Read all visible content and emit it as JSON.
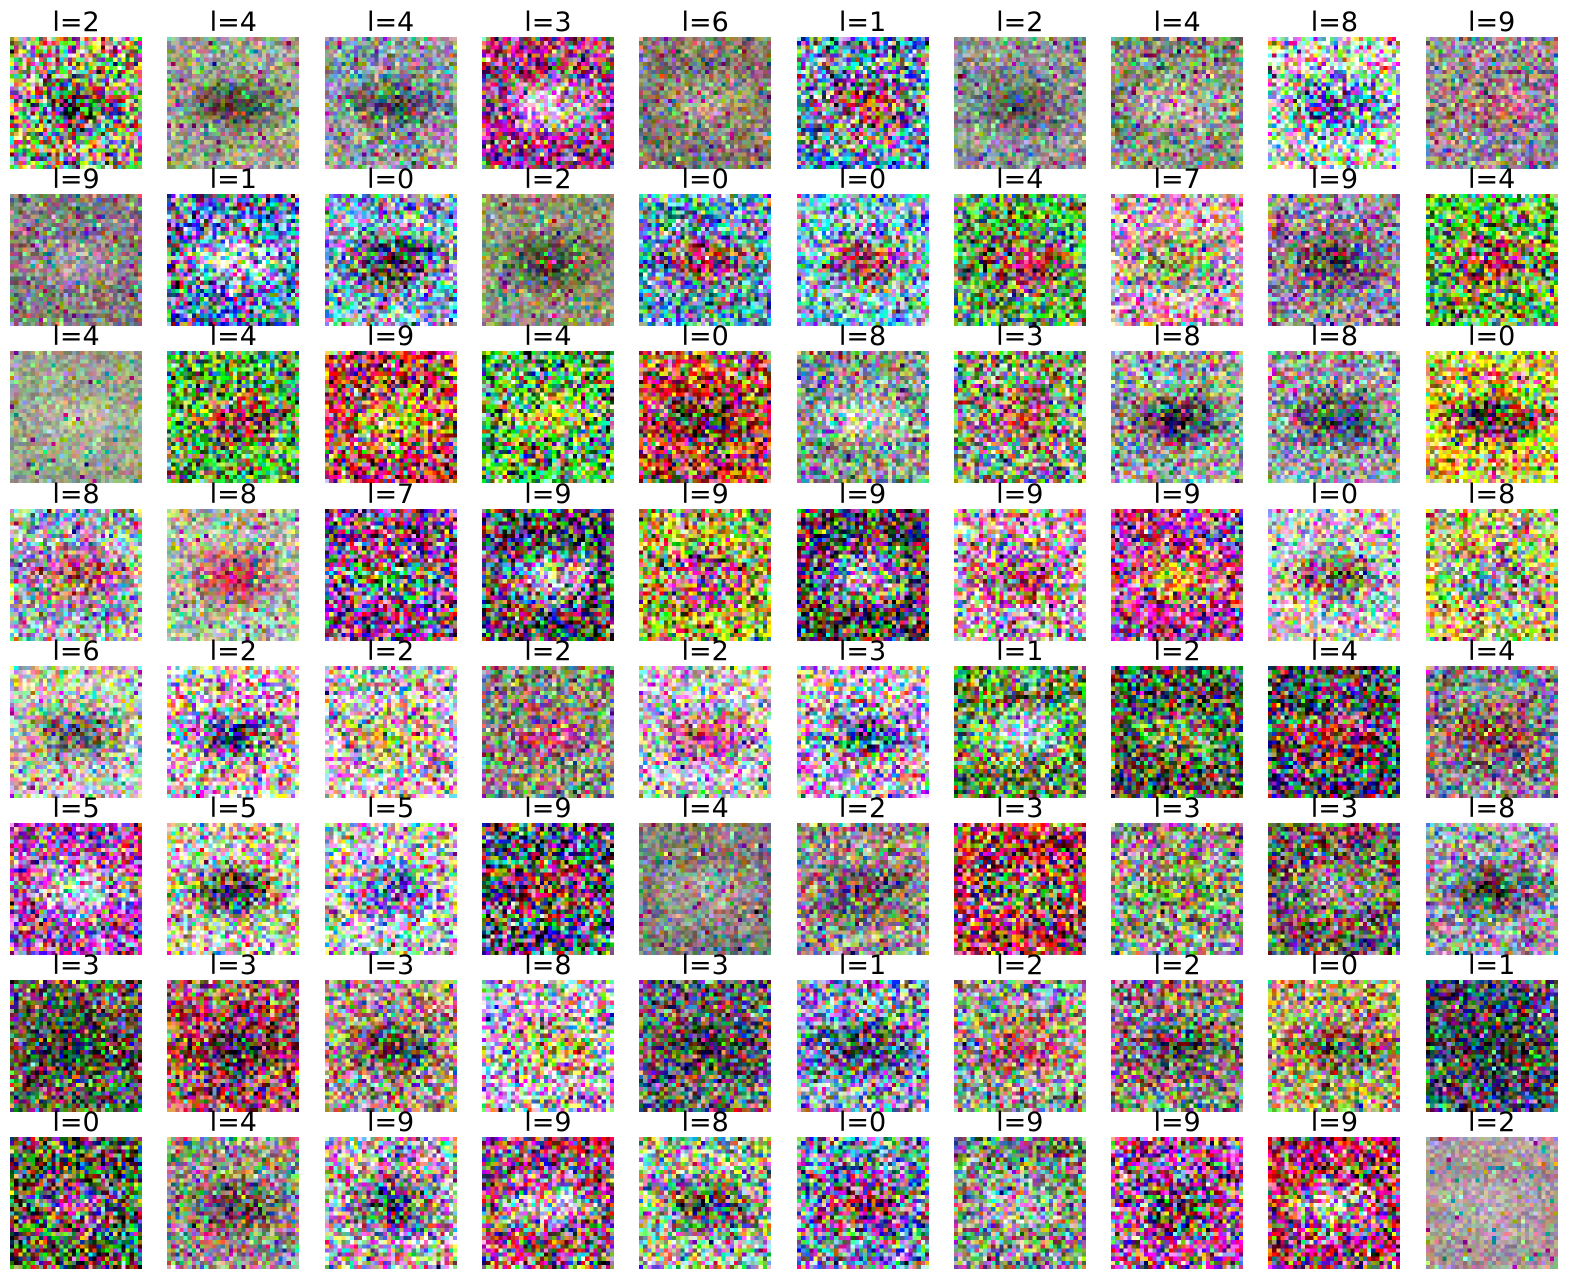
{
  "label_prefix": "l=",
  "grid": {
    "rows": 8,
    "cols": 10
  },
  "labels": [
    [
      2,
      4,
      4,
      3,
      6,
      1,
      2,
      4,
      8,
      9
    ],
    [
      9,
      1,
      0,
      2,
      0,
      0,
      4,
      7,
      9,
      4
    ],
    [
      4,
      4,
      9,
      4,
      0,
      8,
      3,
      8,
      8,
      0
    ],
    [
      8,
      8,
      7,
      9,
      9,
      9,
      9,
      9,
      0,
      8
    ],
    [
      6,
      2,
      2,
      2,
      2,
      3,
      1,
      2,
      4,
      4
    ],
    [
      5,
      5,
      5,
      9,
      4,
      2,
      3,
      3,
      3,
      8
    ],
    [
      3,
      3,
      3,
      8,
      3,
      1,
      2,
      2,
      0,
      1
    ],
    [
      0,
      4,
      9,
      9,
      8,
      0,
      9,
      9,
      9,
      2
    ]
  ],
  "images": [
    [
      {
        "content": "noisy colorful patch with dark horizontal blob in center",
        "palette": [
          "#9aa07a",
          "#3a3a2e",
          "#c8c050"
        ],
        "noise": 0.9
      },
      {
        "content": "muted greenish-gray patch with small dark spot in center",
        "palette": [
          "#9aa088",
          "#3a3a30",
          "#b0b098"
        ],
        "noise": 0.4
      },
      {
        "content": "gray-blue patch with three dark vertical marks",
        "palette": [
          "#8a93a0",
          "#3e4048",
          "#b8b8b0"
        ],
        "noise": 0.5
      },
      {
        "content": "bright white-blue circular glow on dark red-blue background",
        "palette": [
          "#b04080",
          "#e8e8ff",
          "#202050"
        ],
        "noise": 0.8
      },
      {
        "content": "brownish-gray patch with soft light blob",
        "palette": [
          "#8a8070",
          "#c0b090",
          "#5a5650"
        ],
        "noise": 0.4
      },
      {
        "content": "blue oval centered on multicolor noisy border",
        "palette": [
          "#5080c0",
          "#c04030",
          "#e0d040"
        ],
        "noise": 0.9
      },
      {
        "content": "gray patch with faint dark horizontal shape",
        "palette": [
          "#8c9090",
          "#4a4a48",
          "#a8aab0"
        ],
        "noise": 0.4
      },
      {
        "content": "grayish-green patch with light band across middle",
        "palette": [
          "#909880",
          "#c8d0b8",
          "#5a6050"
        ],
        "noise": 0.5
      },
      {
        "content": "vivid noisy patch with blue bottom band",
        "palette": [
          "#e8e8e8",
          "#2030c0",
          "#60d070"
        ],
        "noise": 1.0
      },
      {
        "content": "gray-pink patch with horizontal stripes",
        "palette": [
          "#a09098",
          "#c06070",
          "#60585c"
        ],
        "noise": 0.5
      }
    ],
    [
      {
        "content": "gray-brown patch with faint vertical streaks",
        "palette": [
          "#8a8080",
          "#b0a8a8",
          "#605858"
        ],
        "noise": 0.4
      },
      {
        "content": "blue-white noisy horizontal bands",
        "palette": [
          "#6080c0",
          "#f0f0ff",
          "#302050"
        ],
        "noise": 0.9
      },
      {
        "content": "blue patch with dark horizontal bars",
        "palette": [
          "#80a0c0",
          "#202020",
          "#e0e0f0"
        ],
        "noise": 0.8
      },
      {
        "content": "grayish-olive patch with dark cluster in center",
        "palette": [
          "#8c9070",
          "#3a3a30",
          "#b0b0a0"
        ],
        "noise": 0.4
      },
      {
        "content": "cyan-blue patch with red and black horizontal stripes",
        "palette": [
          "#60b0d0",
          "#c02030",
          "#202020"
        ],
        "noise": 0.8
      },
      {
        "content": "cyan patch with dark red horizontal band",
        "palette": [
          "#70b8d8",
          "#a02030",
          "#e0e0d0"
        ],
        "noise": 0.8
      },
      {
        "content": "green noisy patch with red diagonal streak",
        "palette": [
          "#50a040",
          "#c03050",
          "#c0c0c0"
        ],
        "noise": 0.8
      },
      {
        "content": "pinkish-white patch with green lower region",
        "palette": [
          "#e0b0c0",
          "#60a040",
          "#a04050"
        ],
        "noise": 0.7
      },
      {
        "content": "gray patch with dark horizontal lines and red spots",
        "palette": [
          "#9090a0",
          "#303038",
          "#c04050"
        ],
        "noise": 0.6
      },
      {
        "content": "bright green patch with red and black top band",
        "palette": [
          "#70d040",
          "#c02020",
          "#101010"
        ],
        "noise": 0.9
      }
    ],
    [
      {
        "content": "soft greenish-gray blurred patch",
        "palette": [
          "#a0a890",
          "#c0c8b0",
          "#788070"
        ],
        "noise": 0.3
      },
      {
        "content": "green central blob on red-black noisy background",
        "palette": [
          "#60c040",
          "#c02030",
          "#202020"
        ],
        "noise": 0.9
      },
      {
        "content": "dense multicolor noise with dark horizontal bands",
        "palette": [
          "#d04040",
          "#e0d040",
          "#303030"
        ],
        "noise": 1.0
      },
      {
        "content": "bright multicolor noise with green and yellow patches",
        "palette": [
          "#40c040",
          "#e0e040",
          "#c040c0"
        ],
        "noise": 1.0
      },
      {
        "content": "red-orange patch with dark wavy horizontal bands",
        "palette": [
          "#c04030",
          "#202020",
          "#e0d0c0"
        ],
        "noise": 0.9
      },
      {
        "content": "gray-green patch with light horizontal band",
        "palette": [
          "#90a090",
          "#d0d8d0",
          "#506050"
        ],
        "noise": 0.6
      },
      {
        "content": "muted multicolor noise with faint shape",
        "palette": [
          "#90a080",
          "#c06060",
          "#606060"
        ],
        "noise": 0.8
      },
      {
        "content": "gray-green patch with dark horizontal bar in lower half",
        "palette": [
          "#98a098",
          "#202020",
          "#c0c8c0"
        ],
        "noise": 0.6
      },
      {
        "content": "gray patch with dark horizontal shapes",
        "palette": [
          "#909898",
          "#303030",
          "#c0c0c0"
        ],
        "noise": 0.6
      },
      {
        "content": "yellow patch with black horizontal band and red spots",
        "palette": [
          "#e0e040",
          "#101010",
          "#c02040"
        ],
        "noise": 0.9
      }
    ],
    [
      {
        "content": "gray-blue noisy patch with faint horizontal band",
        "palette": [
          "#98a0a8",
          "#c04050",
          "#e0e0e0"
        ],
        "noise": 0.7
      },
      {
        "content": "light green-gray patch with red horizontal streak",
        "palette": [
          "#a8b8a0",
          "#c02040",
          "#d0d8c8"
        ],
        "noise": 0.5
      },
      {
        "content": "dense multicolor noise with vertical streaks",
        "palette": [
          "#a040a0",
          "#40c040",
          "#303030"
        ],
        "noise": 1.0
      },
      {
        "content": "dark patch with vertical light streaks",
        "palette": [
          "#404050",
          "#e0e0f0",
          "#a06060"
        ],
        "noise": 0.9
      },
      {
        "content": "multicolor noise with yellow-green center",
        "palette": [
          "#c0c040",
          "#a040a0",
          "#404040"
        ],
        "noise": 0.9
      },
      {
        "content": "dark patch with vertical light-blue streaks",
        "palette": [
          "#403848",
          "#c0d0f0",
          "#a04050"
        ],
        "noise": 0.9
      },
      {
        "content": "pink-white noisy patch with vertical streaks",
        "palette": [
          "#e0b0c0",
          "#a03050",
          "#606060"
        ],
        "noise": 0.9
      },
      {
        "content": "multicolor patch with yellow lower region",
        "palette": [
          "#c040a0",
          "#e0c030",
          "#303060"
        ],
        "noise": 0.9
      },
      {
        "content": "pale noisy patch with faint dark blob",
        "palette": [
          "#d0d0c0",
          "#605040",
          "#c080c0"
        ],
        "noise": 0.7
      },
      {
        "content": "yellow-green noisy patch with horizontal bands",
        "palette": [
          "#c0c060",
          "#7090a0",
          "#e0e0e0"
        ],
        "noise": 0.8
      }
    ],
    [
      {
        "content": "pale greenish patch with dark outline shape",
        "palette": [
          "#c0c8b0",
          "#505048",
          "#e0c0e0"
        ],
        "noise": 0.6
      },
      {
        "content": "dark figure with blue and red on light noisy background",
        "palette": [
          "#e0d0e0",
          "#202060",
          "#c02030"
        ],
        "noise": 0.9
      },
      {
        "content": "light noisy multicolor patch",
        "palette": [
          "#e0c0d0",
          "#c0c040",
          "#808080"
        ],
        "noise": 0.8
      },
      {
        "content": "gray patch with colorful cluster in center",
        "palette": [
          "#908888",
          "#c04080",
          "#50a050"
        ],
        "noise": 0.6
      },
      {
        "content": "light patch with pink-red burst in center",
        "palette": [
          "#d8c8d0",
          "#c03060",
          "#70a060"
        ],
        "noise": 0.7
      },
      {
        "content": "bright pink-white center on dark blue-cyan noisy background",
        "palette": [
          "#e0b0d0",
          "#203060",
          "#40c0e0"
        ],
        "noise": 0.9
      },
      {
        "content": "green patch with light oval and dark band",
        "palette": [
          "#70a050",
          "#e0e0e0",
          "#202020"
        ],
        "noise": 0.8
      },
      {
        "content": "dark green noisy textured patch",
        "palette": [
          "#506040",
          "#80a060",
          "#303030"
        ],
        "noise": 0.8
      },
      {
        "content": "dark patch with red-white horizontal band",
        "palette": [
          "#303040",
          "#c03040",
          "#e0e0e0"
        ],
        "noise": 0.9
      },
      {
        "content": "gray patch with red-brown animal-like shape",
        "palette": [
          "#908890",
          "#a03040",
          "#404040"
        ],
        "noise": 0.6
      }
    ],
    [
      {
        "content": "cyan-white shape on multicolor noisy background",
        "palette": [
          "#c040c0",
          "#e0f0f0",
          "#40a060"
        ],
        "noise": 0.9
      },
      {
        "content": "dark vertical shapes on light background",
        "palette": [
          "#d0d0c0",
          "#202020",
          "#c0c040"
        ],
        "noise": 0.8
      },
      {
        "content": "light multicolor patch with vertical streaks",
        "palette": [
          "#d0d0e0",
          "#4040a0",
          "#a0a040"
        ],
        "noise": 0.8
      },
      {
        "content": "dark multicolor patch with red and blue",
        "palette": [
          "#404070",
          "#c03030",
          "#c0c040"
        ],
        "noise": 1.0
      },
      {
        "content": "gray patch with radial streaks",
        "palette": [
          "#888880",
          "#b0a8a0",
          "#505050"
        ],
        "noise": 0.4
      },
      {
        "content": "gray-brown patch with faint dark shape",
        "palette": [
          "#908880",
          "#504848",
          "#c0b8b0"
        ],
        "noise": 0.6
      },
      {
        "content": "red-green noisy patch with dark figure",
        "palette": [
          "#c03040",
          "#60a040",
          "#202020"
        ],
        "noise": 1.0
      },
      {
        "content": "gray-green patch with yellow-green shape",
        "palette": [
          "#a0a090",
          "#80c040",
          "#505050"
        ],
        "noise": 0.7
      },
      {
        "content": "dark-gray patch with circular shape",
        "palette": [
          "#606058",
          "#a0a098",
          "#c04040"
        ],
        "noise": 0.7
      },
      {
        "content": "gray patch with dark horizontal band",
        "palette": [
          "#9898a0",
          "#202830",
          "#c0c0c8"
        ],
        "noise": 0.6
      }
    ],
    [
      {
        "content": "dark green patch with dark diagonal shape",
        "palette": [
          "#506040",
          "#202020",
          "#c04080"
        ],
        "noise": 0.7
      },
      {
        "content": "red-dark patch with vertical shapes",
        "palette": [
          "#a04050",
          "#202020",
          "#c0b0b0"
        ],
        "noise": 0.8
      },
      {
        "content": "gray-beige patch with dark diagonal streaks",
        "palette": [
          "#a8a090",
          "#303030",
          "#c06040"
        ],
        "noise": 0.7
      },
      {
        "content": "light multicolor noisy patch with wavy shapes",
        "palette": [
          "#d0c0d0",
          "#c0c040",
          "#6080c0"
        ],
        "noise": 0.9
      },
      {
        "content": "dark gray patch with vertical tree-like shapes",
        "palette": [
          "#606060",
          "#303030",
          "#a0a0a0"
        ],
        "noise": 0.7
      },
      {
        "content": "blue-gray patch with dark and light blocks",
        "palette": [
          "#8090b0",
          "#202030",
          "#d0d0e0"
        ],
        "noise": 0.8
      },
      {
        "content": "gray patch with red-pink figure",
        "palette": [
          "#909088",
          "#c03050",
          "#e0e0e0"
        ],
        "noise": 0.7
      },
      {
        "content": "gray patch with dark figure",
        "palette": [
          "#888880",
          "#303030",
          "#c04060"
        ],
        "noise": 0.7
      },
      {
        "content": "yellow-brown patch with dark shape",
        "palette": [
          "#b0a060",
          "#404040",
          "#d0c0a0"
        ],
        "noise": 0.7
      },
      {
        "content": "dark blue-brown patch with dark animal shape",
        "palette": [
          "#404858",
          "#202020",
          "#8090a0"
        ],
        "noise": 0.7
      }
    ],
    [
      {
        "content": "dark green multicolor noisy patch",
        "palette": [
          "#405030",
          "#c040a0",
          "#60a040"
        ],
        "noise": 0.9
      },
      {
        "content": "gray patch with dark vertical shapes",
        "palette": [
          "#908880",
          "#404040",
          "#c0b8b0"
        ],
        "noise": 0.6
      },
      {
        "content": "light patch with dark vertical figure",
        "palette": [
          "#c0b8c0",
          "#303030",
          "#c04060"
        ],
        "noise": 0.8
      },
      {
        "content": "multicolor patch with horizontal blue-white band",
        "palette": [
          "#a04070",
          "#e0e0f0",
          "#40a060"
        ],
        "noise": 0.9
      },
      {
        "content": "light green patch with dark lower band",
        "palette": [
          "#a0b090",
          "#303030",
          "#e0e0d0"
        ],
        "noise": 0.8
      },
      {
        "content": "multicolor patch with red-dark center",
        "palette": [
          "#8080b0",
          "#a02030",
          "#40c0a0"
        ],
        "noise": 0.9
      },
      {
        "content": "gray-green patch with light vertical shapes",
        "palette": [
          "#909080",
          "#d0d0c0",
          "#404040"
        ],
        "noise": 0.7
      },
      {
        "content": "dense multicolor noisy patch with stripes",
        "palette": [
          "#c040a0",
          "#303030",
          "#a0a040"
        ],
        "noise": 1.0
      },
      {
        "content": "magenta-red noisy patch with light streaks",
        "palette": [
          "#c03060",
          "#e0e0e0",
          "#404040"
        ],
        "noise": 1.0
      },
      {
        "content": "soft pinkish-gray patch with faint diagonal line",
        "palette": [
          "#b0a0a0",
          "#c0b0b0",
          "#806060"
        ],
        "noise": 0.3
      }
    ]
  ]
}
